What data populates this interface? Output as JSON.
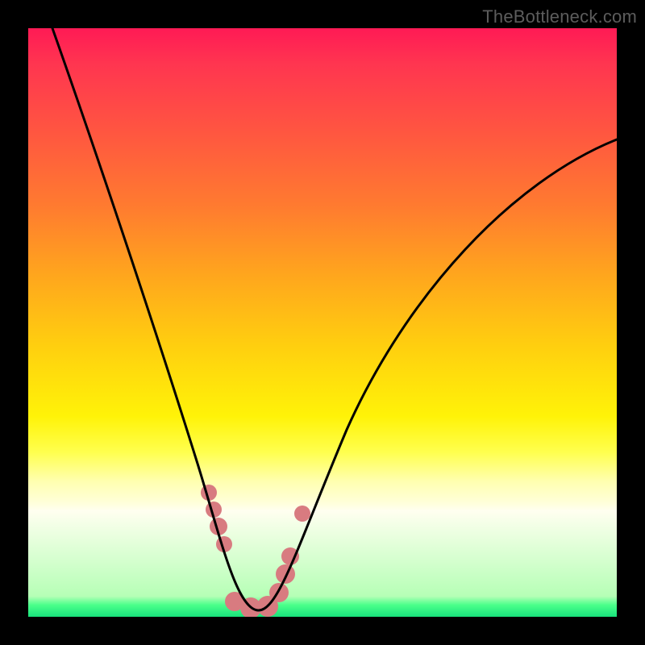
{
  "watermark": "TheBottleneck.com",
  "chart_data": {
    "type": "line",
    "title": "",
    "xlabel": "",
    "ylabel": "",
    "xlim": [
      0,
      100
    ],
    "ylim": [
      0,
      100
    ],
    "grid": false,
    "legend": false,
    "series": [
      {
        "name": "curve-black",
        "color": "#000000",
        "stroke_width": 2,
        "x": [
          4,
          10,
          16,
          22,
          27,
          31,
          34,
          36,
          38,
          40,
          44,
          50,
          58,
          66,
          74,
          82,
          90,
          100
        ],
        "values": [
          100,
          82,
          64,
          46,
          30,
          18,
          10,
          4,
          0,
          0,
          4,
          14,
          28,
          42,
          54,
          64,
          72,
          80
        ]
      }
    ],
    "markers": [
      {
        "name": "bump-left",
        "x_range": [
          30,
          34
        ],
        "y_range": [
          14,
          22
        ],
        "color": "#d87b80",
        "shape": "rounded"
      },
      {
        "name": "bump-bottom",
        "x_range": [
          34,
          44
        ],
        "y_range": [
          0,
          4
        ],
        "color": "#d87b80",
        "shape": "rounded"
      },
      {
        "name": "bump-right",
        "x_range": [
          42,
          45
        ],
        "y_range": [
          4,
          14
        ],
        "color": "#d87b80",
        "shape": "rounded"
      },
      {
        "name": "dot-upper-right",
        "x": 46,
        "y": 18,
        "color": "#d87b80",
        "shape": "circle"
      }
    ],
    "valley_x": 39
  }
}
